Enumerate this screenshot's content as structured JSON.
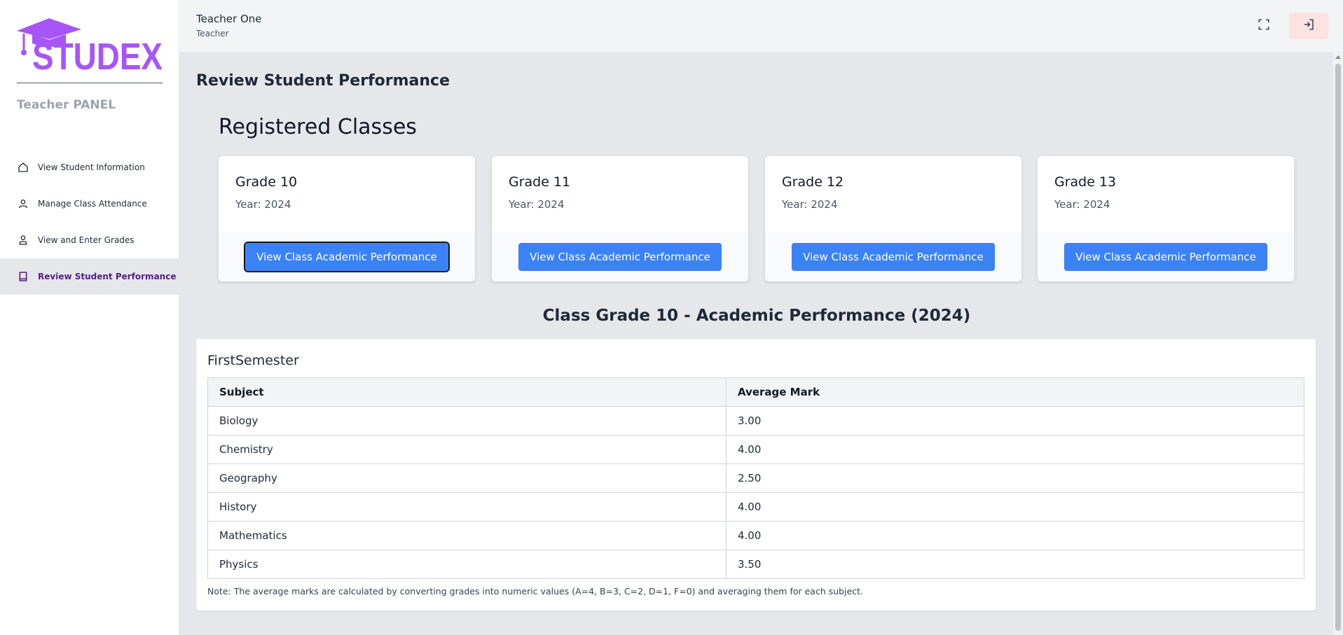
{
  "brand": {
    "logo_text": "STUDEX",
    "logo_color": "#a855f7",
    "panel_title": "Teacher PANEL"
  },
  "sidebar": {
    "items": [
      {
        "label": "View Student Information",
        "icon": "home-icon"
      },
      {
        "label": "Manage Class Attendance",
        "icon": "user-icon"
      },
      {
        "label": "View and Enter Grades",
        "icon": "user-check-icon"
      },
      {
        "label": "Review Student Performance",
        "icon": "book-icon",
        "active": true
      }
    ]
  },
  "header": {
    "user_name": "Teacher One",
    "user_role": "Teacher",
    "icons": [
      "fullscreen-icon",
      "logout-icon"
    ]
  },
  "main": {
    "page_title": "Review Student Performance",
    "section_title": "Registered Classes",
    "classes": [
      {
        "title": "Grade 10",
        "year": "Year: 2024",
        "button": "View Class Academic Performance"
      },
      {
        "title": "Grade 11",
        "year": "Year: 2024",
        "button": "View Class Academic Performance"
      },
      {
        "title": "Grade 12",
        "year": "Year: 2024",
        "button": "View Class Academic Performance"
      },
      {
        "title": "Grade 13",
        "year": "Year: 2024",
        "button": "View Class Academic Performance"
      }
    ],
    "performance": {
      "title": "Class Grade 10 - Academic Performance (2024)",
      "semester": "FirstSemester",
      "headers": [
        "Subject",
        "Average Mark"
      ],
      "rows": [
        {
          "subject": "Biology",
          "mark": "3.00"
        },
        {
          "subject": "Chemistry",
          "mark": "4.00"
        },
        {
          "subject": "Geography",
          "mark": "2.50"
        },
        {
          "subject": "History",
          "mark": "4.00"
        },
        {
          "subject": "Mathematics",
          "mark": "4.00"
        },
        {
          "subject": "Physics",
          "mark": "3.50"
        }
      ],
      "note": "Note: The average marks are calculated by converting grades into numeric values (A=4, B=3, C=2, D=1, F=0) and averaging them for each subject."
    }
  },
  "colors": {
    "accent": "#3b82f6",
    "active_nav": "#581c87",
    "logout_bg": "#fee2e2"
  }
}
